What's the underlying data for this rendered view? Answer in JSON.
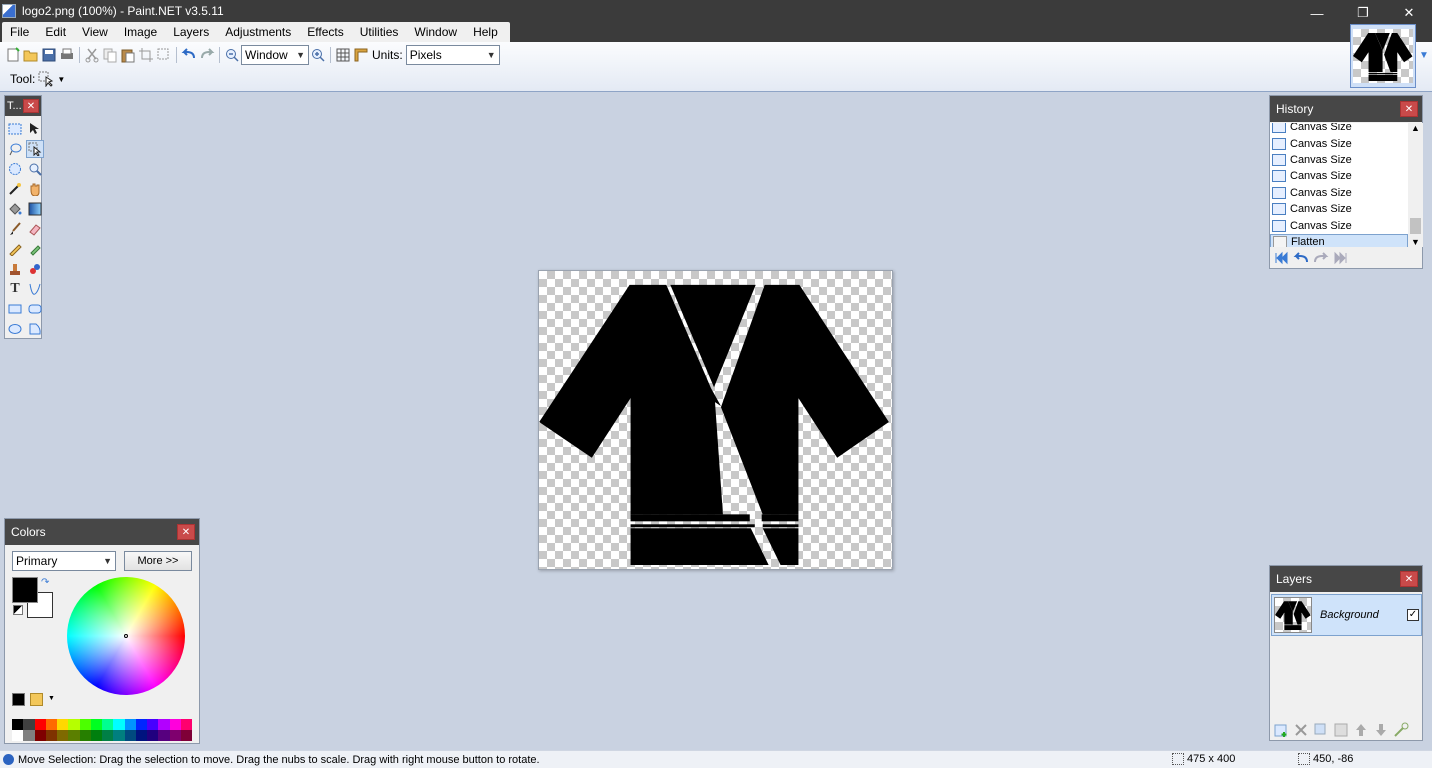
{
  "window": {
    "title": "logo2.png (100%) - Paint.NET v3.5.11",
    "minimize_glyph": "—",
    "restore_glyph": "❐",
    "close_glyph": "✕"
  },
  "menu": [
    "File",
    "Edit",
    "View",
    "Image",
    "Layers",
    "Adjustments",
    "Effects",
    "Utilities",
    "Window",
    "Help"
  ],
  "toolbar": {
    "zoom_value": "Window",
    "units_label": "Units:",
    "units_value": "Pixels",
    "tool_label": "Tool:"
  },
  "tools_panel": {
    "title": "T...",
    "close_glyph": "✕"
  },
  "history": {
    "title": "History",
    "close_glyph": "✕",
    "items": [
      "Canvas Size",
      "Canvas Size",
      "Canvas Size",
      "Canvas Size",
      "Canvas Size",
      "Canvas Size",
      "Canvas Size",
      "Flatten"
    ],
    "selected_index": 7
  },
  "layers": {
    "title": "Layers",
    "close_glyph": "✕",
    "layer_name": "Background",
    "visible_glyph": "✓"
  },
  "colors": {
    "title": "Colors",
    "close_glyph": "✕",
    "mode": "Primary",
    "more_button": "More >>",
    "primary_color": "#000000",
    "secondary_color": "#ffffff",
    "palette_top": [
      "#000000",
      "#404040",
      "#ff0000",
      "#ff6a00",
      "#ffd800",
      "#b6ff00",
      "#4cff00",
      "#00ff21",
      "#00ff90",
      "#00ffff",
      "#0094ff",
      "#0026ff",
      "#4800ff",
      "#b200ff",
      "#ff00dc",
      "#ff006e"
    ],
    "palette_bottom": [
      "#ffffff",
      "#808080",
      "#7f0000",
      "#7f3300",
      "#7f6a00",
      "#5b7f00",
      "#267f00",
      "#007f0e",
      "#007f46",
      "#007f7f",
      "#004a7f",
      "#00137f",
      "#21007f",
      "#57007f",
      "#7f006e",
      "#7f0037"
    ]
  },
  "status": {
    "message": "Move Selection: Drag the selection to move. Drag the nubs to scale. Drag with right mouse button to rotate.",
    "image_size": "475 x 400",
    "cursor_coords": "450, -86"
  }
}
